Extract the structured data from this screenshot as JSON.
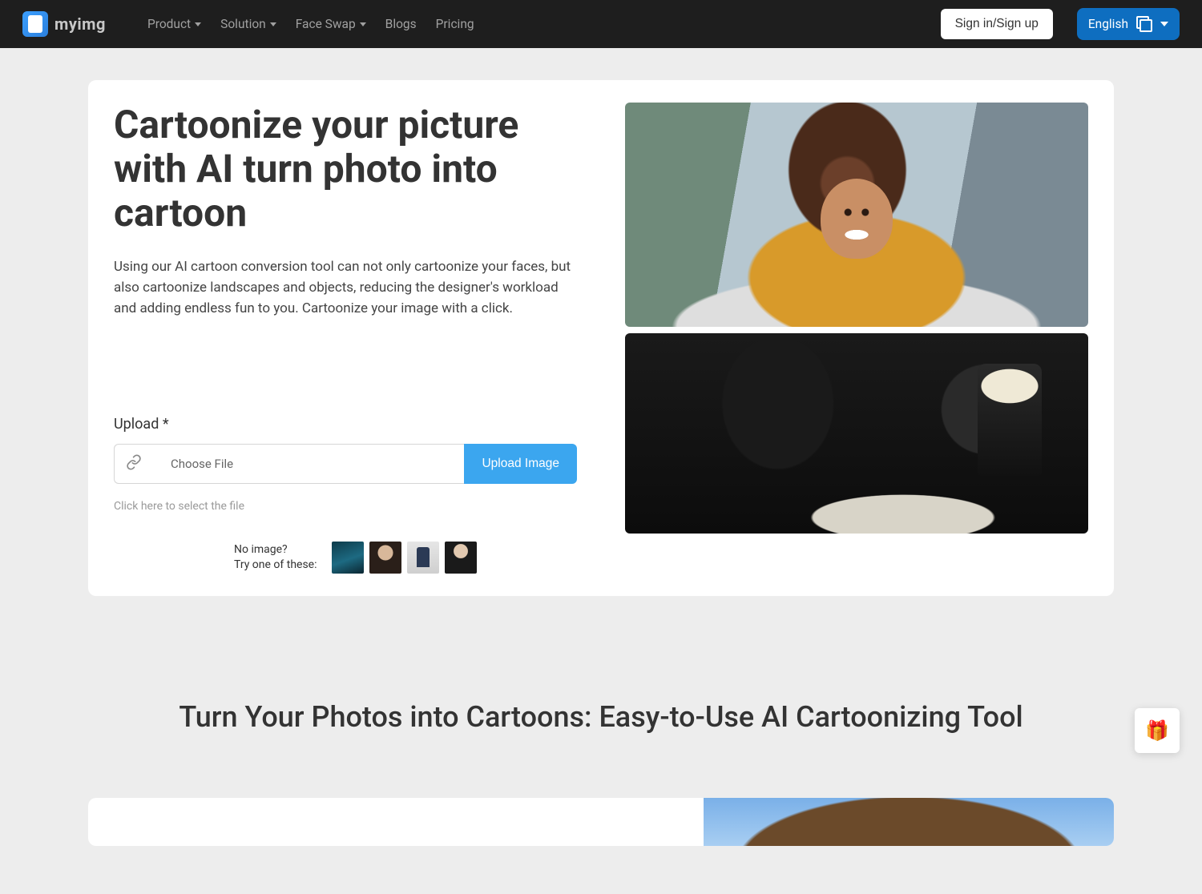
{
  "header": {
    "logo_text": "myimg",
    "nav": {
      "product": "Product",
      "solution": "Solution",
      "face_swap": "Face Swap",
      "blogs": "Blogs",
      "pricing": "Pricing"
    },
    "signin": "Sign in/Sign up",
    "language": "English"
  },
  "hero": {
    "title": "Cartoonize your picture with AI turn photo into cartoon",
    "description": "Using our AI cartoon conversion tool can not only cartoonize your faces, but also cartoonize landscapes and objects, reducing the designer's workload and adding endless fun to you. Cartoonize your image with a click.",
    "upload_label": "Upload *",
    "choose_file": "Choose File",
    "upload_btn": "Upload Image",
    "upload_hint": "Click here to select the file",
    "no_image_line1": "No image?",
    "no_image_line2": "Try one of these:"
  },
  "section2": {
    "title": "Turn Your Photos into Cartoons: Easy-to-Use AI Cartoonizing Tool"
  },
  "gift_icon": "🎁"
}
